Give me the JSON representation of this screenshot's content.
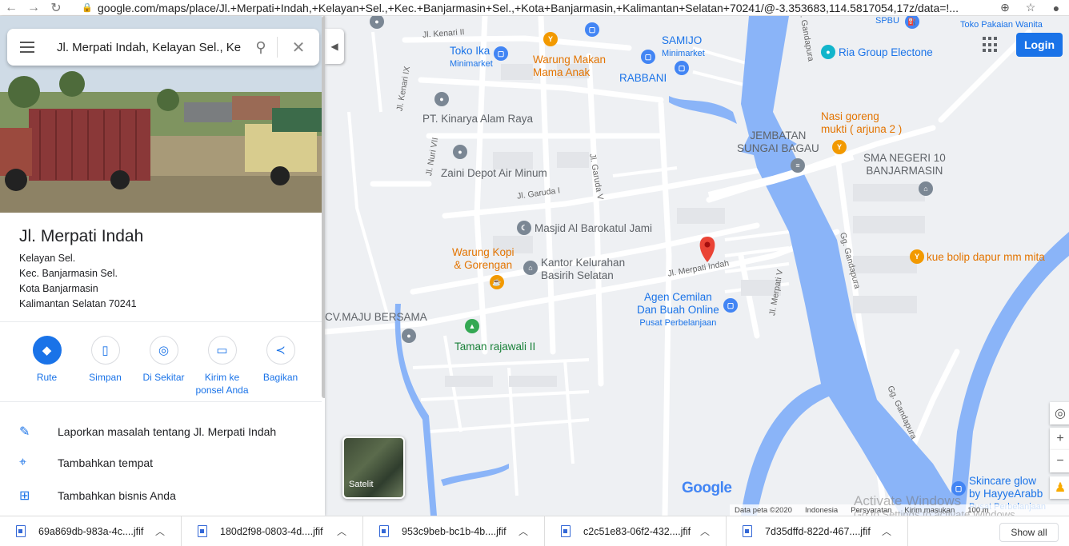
{
  "browser": {
    "url": "google.com/maps/place/Jl.+Merpati+Indah,+Kelayan+Sel.,+Kec.+Banjarmasin+Sel.,+Kota+Banjarmasin,+Kalimantan+Selatan+70241/@-3.353683,114.5817054,17z/data=!...",
    "back_icon": "arrow-left",
    "forward_icon": "arrow-right",
    "reload_icon": "reload"
  },
  "search": {
    "query": "Jl. Merpati Indah, Kelayan Sel., Ke",
    "menu_icon": "hamburger",
    "search_icon": "magnifier",
    "close_icon": "x"
  },
  "place": {
    "title": "Jl. Merpati Indah",
    "address_lines": [
      "Kelayan Sel.",
      "Kec. Banjarmasin Sel.",
      "Kota Banjarmasin",
      "Kalimantan Selatan 70241"
    ]
  },
  "actions": [
    {
      "label": "Rute",
      "icon": "directions"
    },
    {
      "label": "Simpan",
      "icon": "bookmark"
    },
    {
      "label": "Di Sekitar",
      "icon": "nearby"
    },
    {
      "label": "Kirim ke ponsel Anda",
      "icon": "send-to-phone"
    },
    {
      "label": "Bagikan",
      "icon": "share"
    }
  ],
  "list_items": [
    {
      "label": "Laporkan masalah tentang Jl. Merpati Indah",
      "icon": "pencil"
    },
    {
      "label": "Tambahkan tempat",
      "icon": "add-place"
    },
    {
      "label": "Tambahkan bisnis Anda",
      "icon": "add-business"
    }
  ],
  "map": {
    "login_label": "Login",
    "satellite_label": "Satelit",
    "google_logo": "Google",
    "attribution": [
      "Data peta ©2020",
      "Indonesia",
      "Persyaratan",
      "Kirim masukan",
      "100 m"
    ],
    "watermark_title": "Activate Windows",
    "watermark_sub": "Go to Settings to activate Windows.",
    "pois": [
      {
        "id": "toko-ika",
        "name": "Toko Ika",
        "sub": "Minimarket"
      },
      {
        "id": "warung-makan",
        "name": "Warung Makan\nMama Anak"
      },
      {
        "id": "samijo",
        "name": "SAMIJO",
        "sub": "Minimarket"
      },
      {
        "id": "rabbani",
        "name": "RABBANI"
      },
      {
        "id": "ria-group",
        "name": "Ria Group Electone"
      },
      {
        "id": "toko-pakaian",
        "name": "Toko Pakaian Wanita"
      },
      {
        "id": "spbu",
        "name": "SPBU"
      },
      {
        "id": "kinarya",
        "name": "PT. Kinarya Alam Raya"
      },
      {
        "id": "zaini",
        "name": "Zaini Depot Air Minum"
      },
      {
        "id": "nasi-goreng",
        "name": "Nasi goreng\nmukti ( arjuna 2 )"
      },
      {
        "id": "jembatan",
        "name": "JEMBATAN\nSUNGAI BAGAU"
      },
      {
        "id": "sma10",
        "name": "SMA NEGERI 10\nBANJARMASIN"
      },
      {
        "id": "masjid",
        "name": "Masjid Al Barokatul Jami"
      },
      {
        "id": "warung-kopi",
        "name": "Warung Kopi\n& Gorengan"
      },
      {
        "id": "kantor",
        "name": "Kantor Kelurahan\nBasirih Selatan"
      },
      {
        "id": "kue-bolip",
        "name": "kue bolip dapur mm mita"
      },
      {
        "id": "agen-cemilan",
        "name": "Agen Cemilan\nDan Buah Online",
        "sub": "Pusat Perbelanjaan"
      },
      {
        "id": "cv-maju",
        "name": "CV.MAJU BERSAMA"
      },
      {
        "id": "taman",
        "name": "Taman rajawali II"
      },
      {
        "id": "skincare",
        "name": "Skincare glow\nby HayyeArabb",
        "sub": "Pusat Perbelanjaan"
      }
    ],
    "streets": [
      "Jl. Kenari II",
      "Jl. Kenari IX",
      "Jl. Nuri VII",
      "Jl. Garuda I",
      "Jl. Garuda V",
      "Jl. Merpati Indah",
      "Jl. Merpati V",
      "Gg. Gandapura",
      "Gg. Gandapura",
      "Gg. Gandapura"
    ]
  },
  "downloads": [
    "69a869db-983a-4c....jfif",
    "180d2f98-0803-4d....jfif",
    "953c9beb-bc1b-4b....jfif",
    "c2c51e83-06f2-432....jfif",
    "7d35dffd-822d-467....jfif"
  ],
  "show_all_label": "Show all",
  "colors": {
    "accent": "#1a73e8",
    "water": "#8ab4f8",
    "pin_red": "#ea4335"
  }
}
